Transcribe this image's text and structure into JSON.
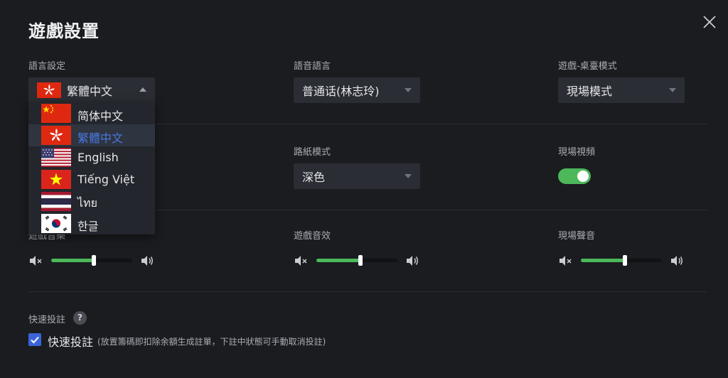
{
  "title": "遊戲設置",
  "language": {
    "label": "語言設定",
    "selected": "繁體中文",
    "options": [
      {
        "label": "简体中文",
        "flag": "cn-flag"
      },
      {
        "label": "繁體中文",
        "flag": "hk-flag"
      },
      {
        "label": "English",
        "flag": "us-flag"
      },
      {
        "label": "Tiếng Việt",
        "flag": "vn-flag"
      },
      {
        "label": "ไทย",
        "flag": "th-flag"
      },
      {
        "label": "한글",
        "flag": "kr-flag"
      }
    ],
    "active_index": 1
  },
  "voice_language": {
    "label": "語音語言",
    "selected": "普通话(林志玲)"
  },
  "table_mode": {
    "label": "遊戲-桌臺模式",
    "selected": "現場模式"
  },
  "road_mode": {
    "label": "路紙模式",
    "selected": "深色"
  },
  "live_video": {
    "label": "現場視頻",
    "enabled": true
  },
  "volumes": [
    {
      "label": "遊戲音樂",
      "percent": 53
    },
    {
      "label": "遊戲音效",
      "percent": 54
    },
    {
      "label": "現場聲音",
      "percent": 54
    }
  ],
  "quick_bet": {
    "section_label": "快速投註",
    "help": "?",
    "checkbox_label": "快速投註",
    "description": "(放置籌碼即扣除余額生成註單，下註中狀態可手動取消投註)",
    "checked": true
  },
  "colors": {
    "accent": "#4cb85a",
    "active_text": "#4a78e0",
    "checkbox": "#3a64d8"
  }
}
